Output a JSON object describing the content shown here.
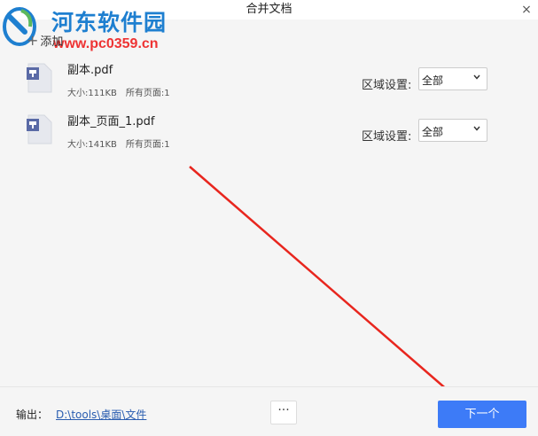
{
  "window": {
    "title": "合并文档",
    "close_glyph": "×"
  },
  "watermark": {
    "name": "河东软件园",
    "url": "www.pc0359.cn"
  },
  "toolbar": {
    "add_label": "添加",
    "add_glyph": "+"
  },
  "files": [
    {
      "name": "副本.pdf",
      "size": "大小:111KB",
      "pages": "所有页面:1",
      "region_label": "区域设置:",
      "region_value": "全部"
    },
    {
      "name": "副本_页面_1.pdf",
      "size": "大小:141KB",
      "pages": "所有页面:1",
      "region_label": "区域设置:",
      "region_value": "全部"
    }
  ],
  "footer": {
    "output_label": "输出：",
    "output_path": "D:\\tools\\桌面\\文件",
    "more_label": "···",
    "next_label": "下一个"
  },
  "colors": {
    "accent": "#3d7bf7",
    "annotation_arrow": "#e8261e",
    "link": "#2a5db0"
  }
}
